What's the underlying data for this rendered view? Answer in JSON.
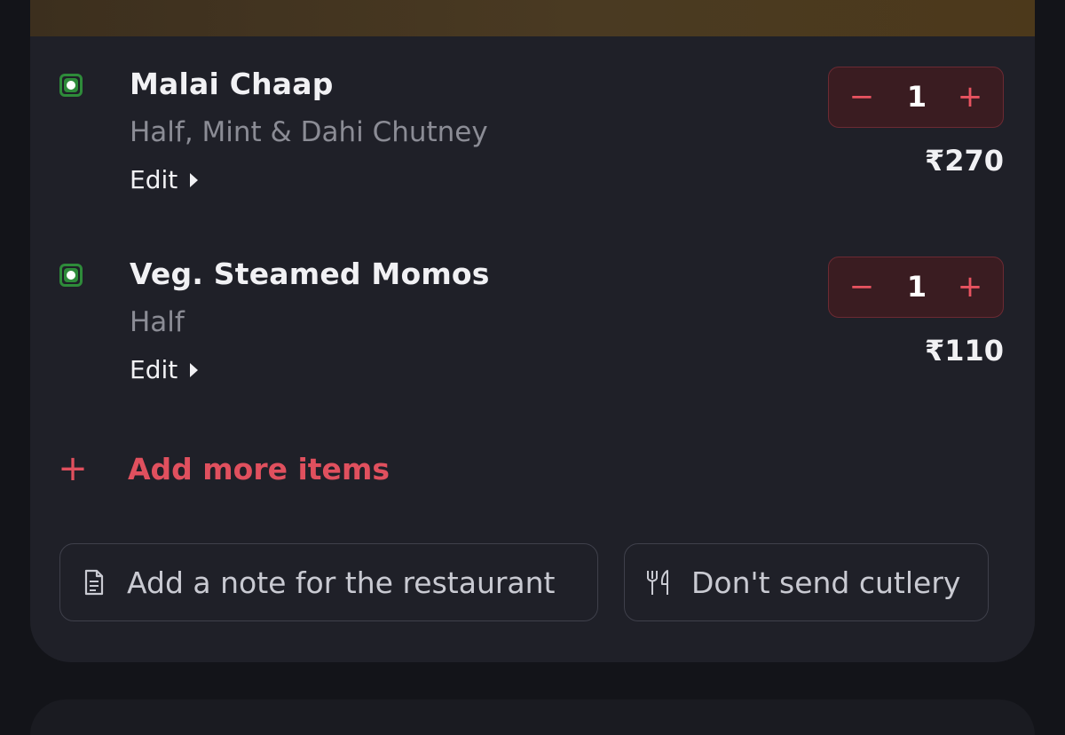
{
  "items": [
    {
      "name": "Malai Chaap",
      "description": "Half, Mint & Dahi Chutney",
      "edit_label": "Edit",
      "quantity": "1",
      "price": "₹270"
    },
    {
      "name": "Veg. Steamed Momos",
      "description": "Half",
      "edit_label": "Edit",
      "quantity": "1",
      "price": "₹110"
    }
  ],
  "stepper": {
    "minus_symbol": "−",
    "plus_symbol": "+"
  },
  "add_more": {
    "icon": "+",
    "label": "Add more items"
  },
  "actions": {
    "note_label": "Add a note for the restaurant",
    "note_icon": "document-icon",
    "cutlery_label": "Don't send cutlery",
    "cutlery_icon": "cutlery-icon"
  },
  "colors": {
    "accent": "#e0505e",
    "veg_green": "#2e8b3a",
    "stepper_bg": "#3a1c21",
    "card_bg": "#1f2028",
    "page_bg": "#131419"
  }
}
